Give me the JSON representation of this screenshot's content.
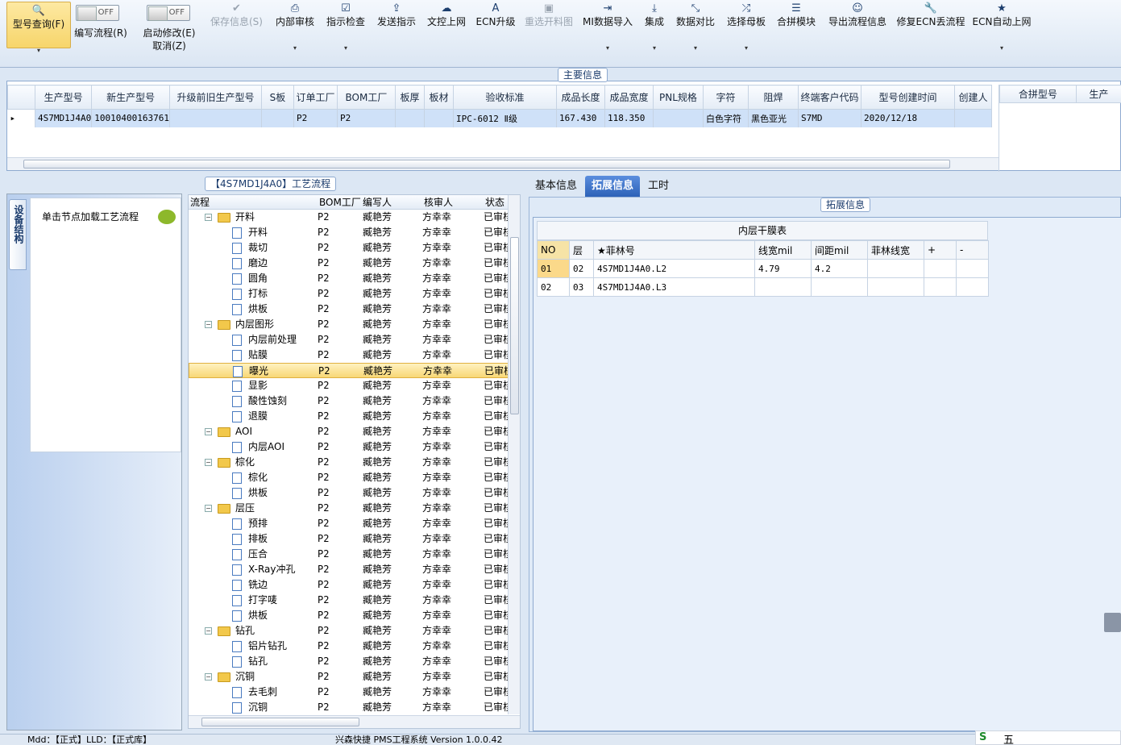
{
  "toolbar": {
    "buttons": [
      {
        "label": "型号查询(F)",
        "icon": "search-icon",
        "glyph": "🔍",
        "selected": true,
        "dropdown": true
      },
      {
        "label": "保存信息(S)",
        "icon": "check-icon",
        "glyph": "✔",
        "disabled": true
      },
      {
        "label": "内部审核",
        "icon": "print-icon",
        "glyph": "⎙",
        "dropdown": true
      },
      {
        "label": "指示检查",
        "icon": "checkbox-icon",
        "glyph": "☑",
        "dropdown": true
      },
      {
        "label": "发送指示",
        "icon": "upload-icon",
        "glyph": "⇪"
      },
      {
        "label": "文控上网",
        "icon": "cloud-upload-icon",
        "glyph": "☁"
      },
      {
        "label": "ECN升级",
        "icon": "text-icon",
        "glyph": "A"
      },
      {
        "label": "重选开料图",
        "icon": "image-icon",
        "glyph": "▣",
        "disabled": true
      },
      {
        "label": "MI数据导入",
        "icon": "import-icon",
        "glyph": "⇥",
        "dropdown": true
      },
      {
        "label": "集成",
        "icon": "download-icon",
        "glyph": "⤓",
        "dropdown": true
      },
      {
        "label": "数据对比",
        "icon": "compress-icon",
        "glyph": "⤡",
        "dropdown": true
      },
      {
        "label": "选择母板",
        "icon": "shuffle-icon",
        "glyph": "⤮",
        "dropdown": true
      },
      {
        "label": "合拼模块",
        "icon": "list-icon",
        "glyph": "☰"
      },
      {
        "label": "导出流程信息",
        "icon": "smile-icon",
        "glyph": "☺"
      },
      {
        "label": "修复ECN丢流程",
        "icon": "wrench-icon",
        "glyph": "🔧"
      },
      {
        "label": "ECN自动上网",
        "icon": "star-icon",
        "glyph": "★",
        "dropdown": true
      }
    ],
    "toggle1": {
      "state": "OFF",
      "label": "编写流程(R)"
    },
    "toggle2": {
      "state": "OFF",
      "label": "启动修改(E)",
      "sub": "取消(Z)"
    }
  },
  "main_info": {
    "title": "主要信息",
    "columns": [
      "生产型号",
      "新生产型号",
      "升级前旧生产型号",
      "S板",
      "订单工厂",
      "BOM工厂",
      "板厚",
      "板材",
      "验收标准",
      "成品长度",
      "成品宽度",
      "PNL规格",
      "字符",
      "阻焊",
      "终端客户代码",
      "型号创建时间",
      "创建人"
    ],
    "rows": [
      [
        "4S7MD1J4A0",
        "10010400163761",
        "",
        "",
        "P2",
        "P2",
        "",
        "",
        "IPC-6012 Ⅱ级",
        "167.430",
        "118.350",
        "",
        "白色字符",
        "黑色亚光",
        "S7MD",
        "2020/12/18",
        ""
      ]
    ],
    "side_columns": [
      "合拼型号",
      "生产"
    ]
  },
  "process": {
    "title": "【4S7MD1J4A0】工艺流程",
    "vertical_tab": "设备结构",
    "hint": "单击节点加载工艺流程",
    "columns": [
      "流程",
      "BOM工厂",
      "编写人",
      "核审人",
      "状态"
    ],
    "rows": [
      {
        "name": "开料",
        "level": 0,
        "bom": "P2",
        "writer": "臧艳芳",
        "checker": "方幸幸",
        "status": "已审核"
      },
      {
        "name": "开料",
        "level": 1,
        "bom": "P2",
        "writer": "臧艳芳",
        "checker": "方幸幸",
        "status": "已审核"
      },
      {
        "name": "裁切",
        "level": 1,
        "bom": "P2",
        "writer": "臧艳芳",
        "checker": "方幸幸",
        "status": "已审核"
      },
      {
        "name": "磨边",
        "level": 1,
        "bom": "P2",
        "writer": "臧艳芳",
        "checker": "方幸幸",
        "status": "已审核"
      },
      {
        "name": "圆角",
        "level": 1,
        "bom": "P2",
        "writer": "臧艳芳",
        "checker": "方幸幸",
        "status": "已审核"
      },
      {
        "name": "打标",
        "level": 1,
        "bom": "P2",
        "writer": "臧艳芳",
        "checker": "方幸幸",
        "status": "已审核"
      },
      {
        "name": "烘板",
        "level": 1,
        "bom": "P2",
        "writer": "臧艳芳",
        "checker": "方幸幸",
        "status": "已审核"
      },
      {
        "name": "内层图形",
        "level": 0,
        "bom": "P2",
        "writer": "臧艳芳",
        "checker": "方幸幸",
        "status": "已审核"
      },
      {
        "name": "内层前处理",
        "level": 1,
        "bom": "P2",
        "writer": "臧艳芳",
        "checker": "方幸幸",
        "status": "已审核"
      },
      {
        "name": "贴膜",
        "level": 1,
        "bom": "P2",
        "writer": "臧艳芳",
        "checker": "方幸幸",
        "status": "已审核"
      },
      {
        "name": "曝光",
        "level": 1,
        "bom": "P2",
        "writer": "臧艳芳",
        "checker": "方幸幸",
        "status": "已审核",
        "selected": true
      },
      {
        "name": "显影",
        "level": 1,
        "bom": "P2",
        "writer": "臧艳芳",
        "checker": "方幸幸",
        "status": "已审核"
      },
      {
        "name": "酸性蚀刻",
        "level": 1,
        "bom": "P2",
        "writer": "臧艳芳",
        "checker": "方幸幸",
        "status": "已审核"
      },
      {
        "name": "退膜",
        "level": 1,
        "bom": "P2",
        "writer": "臧艳芳",
        "checker": "方幸幸",
        "status": "已审核"
      },
      {
        "name": "AOI",
        "level": 0,
        "bom": "P2",
        "writer": "臧艳芳",
        "checker": "方幸幸",
        "status": "已审核"
      },
      {
        "name": "内层AOI",
        "level": 1,
        "bom": "P2",
        "writer": "臧艳芳",
        "checker": "方幸幸",
        "status": "已审核"
      },
      {
        "name": "棕化",
        "level": 0,
        "bom": "P2",
        "writer": "臧艳芳",
        "checker": "方幸幸",
        "status": "已审核"
      },
      {
        "name": "棕化",
        "level": 1,
        "bom": "P2",
        "writer": "臧艳芳",
        "checker": "方幸幸",
        "status": "已审核"
      },
      {
        "name": "烘板",
        "level": 1,
        "bom": "P2",
        "writer": "臧艳芳",
        "checker": "方幸幸",
        "status": "已审核"
      },
      {
        "name": "层压",
        "level": 0,
        "bom": "P2",
        "writer": "臧艳芳",
        "checker": "方幸幸",
        "status": "已审核"
      },
      {
        "name": "预排",
        "level": 1,
        "bom": "P2",
        "writer": "臧艳芳",
        "checker": "方幸幸",
        "status": "已审核"
      },
      {
        "name": "排板",
        "level": 1,
        "bom": "P2",
        "writer": "臧艳芳",
        "checker": "方幸幸",
        "status": "已审核"
      },
      {
        "name": "压合",
        "level": 1,
        "bom": "P2",
        "writer": "臧艳芳",
        "checker": "方幸幸",
        "status": "已审核"
      },
      {
        "name": "X-Ray冲孔",
        "level": 1,
        "bom": "P2",
        "writer": "臧艳芳",
        "checker": "方幸幸",
        "status": "已审核"
      },
      {
        "name": "铣边",
        "level": 1,
        "bom": "P2",
        "writer": "臧艳芳",
        "checker": "方幸幸",
        "status": "已审核"
      },
      {
        "name": "打字唛",
        "level": 1,
        "bom": "P2",
        "writer": "臧艳芳",
        "checker": "方幸幸",
        "status": "已审核"
      },
      {
        "name": "烘板",
        "level": 1,
        "bom": "P2",
        "writer": "臧艳芳",
        "checker": "方幸幸",
        "status": "已审核"
      },
      {
        "name": "钻孔",
        "level": 0,
        "bom": "P2",
        "writer": "臧艳芳",
        "checker": "方幸幸",
        "status": "已审核"
      },
      {
        "name": "铝片钻孔",
        "level": 1,
        "bom": "P2",
        "writer": "臧艳芳",
        "checker": "方幸幸",
        "status": "已审核"
      },
      {
        "name": "钻孔",
        "level": 1,
        "bom": "P2",
        "writer": "臧艳芳",
        "checker": "方幸幸",
        "status": "已审核"
      },
      {
        "name": "沉铜",
        "level": 0,
        "bom": "P2",
        "writer": "臧艳芳",
        "checker": "方幸幸",
        "status": "已审核"
      },
      {
        "name": "去毛刺",
        "level": 1,
        "bom": "P2",
        "writer": "臧艳芳",
        "checker": "方幸幸",
        "status": "已审核"
      },
      {
        "name": "沉铜",
        "level": 1,
        "bom": "P2",
        "writer": "臧艳芳",
        "checker": "方幸幸",
        "status": "已审核"
      }
    ]
  },
  "right_tabs": [
    "基本信息",
    "拓展信息",
    "工时"
  ],
  "right_active_tab": 1,
  "ext": {
    "title": "拓展信息",
    "table_title": "内层干膜表",
    "columns": [
      "NO",
      "层",
      "★菲林号",
      "线宽mil",
      "间距mil",
      "菲林线宽",
      "+",
      "-"
    ],
    "rows": [
      [
        "01",
        "02",
        "4S7MD1J4A0.L2",
        "4.79",
        "4.2",
        "",
        "",
        ""
      ],
      [
        "02",
        "03",
        "4S7MD1J4A0.L3",
        "",
        "",
        "",
        "",
        ""
      ]
    ]
  },
  "status_bar": {
    "left": "Mdd：【正式】LLD：【正式库】",
    "center": "兴森快捷 PMS工程系统 Version 1.0.0.42",
    "ime": "五"
  }
}
